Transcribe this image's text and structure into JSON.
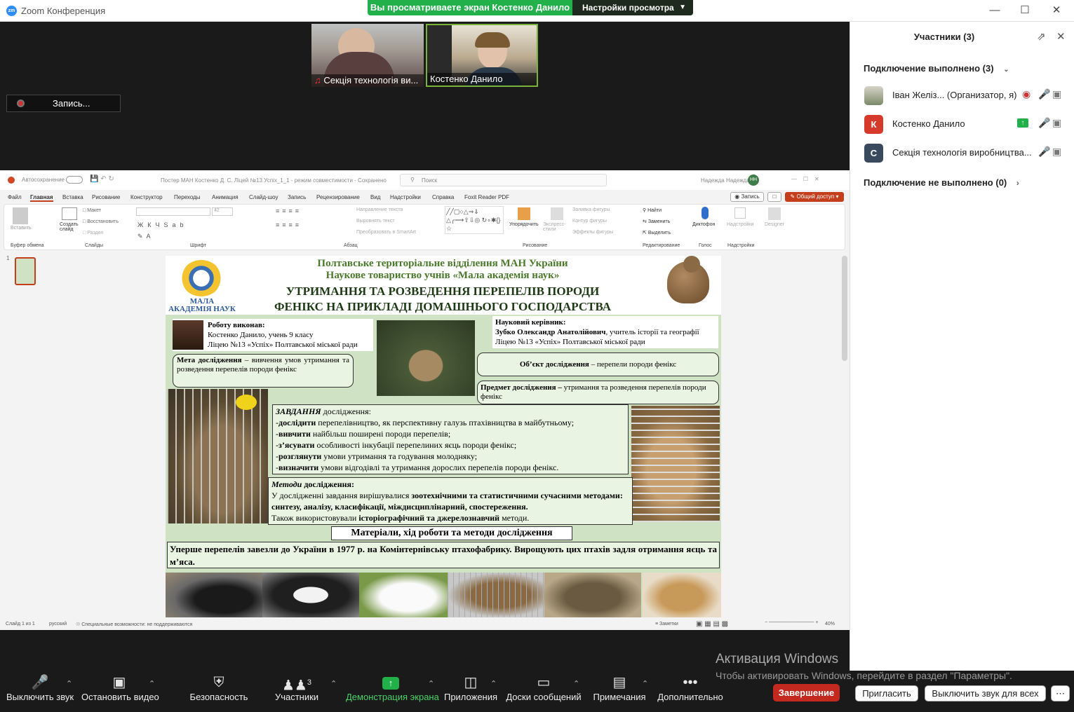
{
  "window": {
    "title": "Zoom Конференция",
    "banner": "Вы просматриваете экран Костенко Данило",
    "view_settings": "Настройки просмотра"
  },
  "videos": [
    {
      "name": "Секція технологія ви..."
    },
    {
      "name": "Костенко Данило"
    }
  ],
  "recording": {
    "label": "Запись..."
  },
  "ppt": {
    "titlebar": {
      "autosave": "Автосохранение",
      "doc": "Постер МАН Костенко Д. С. Лiцей №13 Успіх_1_1  -  режим совместимости  -  Сохранено",
      "search": "Поиск",
      "user": "Надежда Надежда",
      "initials": "НН"
    },
    "tabs": [
      "Файл",
      "Главная",
      "Вставка",
      "Рисование",
      "Конструктор",
      "Переходы",
      "Анимация",
      "Слайд-шоу",
      "Запись",
      "Рецензирование",
      "Вид",
      "Надстройки",
      "Справка",
      "Foxit Reader PDF"
    ],
    "record_btn": "Запись",
    "share_btn": "Общий доступ",
    "groups": [
      "Буфер обмена",
      "Слайды",
      "Шрифт",
      "Абзац",
      "Рисование",
      "Редактирование",
      "Голос",
      "Надстройки"
    ],
    "ribbon_items": {
      "paste": "Вставить",
      "create": "Создать слайд",
      "layout": "Макет",
      "restore": "Восстановить",
      "section": "Раздел",
      "dir": "Направление текста",
      "align": "Выровнять текст",
      "smartart": "Преобразовать в SmartArt",
      "arrange": "Упорядочить",
      "quick": "Экспресс-стили",
      "fill": "Заливка фигуры",
      "outline": "Контур фигуры",
      "effects": "Эффекты фигуры",
      "find": "Найти",
      "replace": "Заменить",
      "select": "Выделить",
      "dictate": "Диктофон",
      "addins": "Надстройки",
      "designer": "Designer",
      "font_size": "42"
    },
    "status": {
      "slide": "Слайд 1 из 1",
      "lang": "русский",
      "access": "Специальные возможности: не поддерживаются",
      "notes": "Заметки",
      "zoom": "40%"
    },
    "slide_num": "1"
  },
  "slide": {
    "org1": "Полтавське територіальне відділення МАН України",
    "org2": "Наукове товариство учнів «Мала академія наук»",
    "title1": "УТРИМАННЯ ТА РОЗВЕДЕННЯ ПЕРЕПЕЛІВ ПОРОДИ",
    "title2": "ФЕНІКС НА ПРИКЛАДІ ДОМАШНЬОГО ГОСПОДАРСТВА",
    "logo1": "МАЛА",
    "logo2": "АКАДЕМІЯ НАУК",
    "author_head": "Роботу виконав:",
    "author1": "Костенко Данило, учень 9 класу",
    "author2": "Ліцею №13 «Успіх» Полтавської міської ради",
    "sup_head": "Науковий керівник:",
    "sup_name": "Зубко Олександр Анатолійович",
    "sup_rest": ", учитель історії та географії",
    "sup2": "Ліцею №13 «Успіх» Полтавської міської ради",
    "goal_b": "Мета дослідження",
    "goal": " – вивчення умов утримання та розведення перепелів породи фенікс",
    "object_b": "Об’єкт дослідження",
    "object": " – перепели породи фенікс",
    "subject_b": "Предмет дослідження –",
    "subject": " утримання та розведення перепелів породи фенікс",
    "tasks_b": "ЗАВДАННЯ",
    "tasks_h": " дослідження:",
    "tasks": [
      {
        "b": "дослідити",
        "t": " перепелівництво, як перспективну галузь птахівництва в майбутньому;"
      },
      {
        "b": "вивчити",
        "t": " найбільш поширені породи перепелів;"
      },
      {
        "b": "з’ясувати",
        "t": " особливості інкубації перепелиних яєць породи фенікс;"
      },
      {
        "b": "розглянути",
        "t": " умови утримання та годування молодняку;"
      },
      {
        "b": "визначити",
        "t": " умови відгодівлі та утримання дорослих перепелів породи фенікс."
      }
    ],
    "methods_b": "Методи",
    "methods_h": " дослідження:",
    "methods1": "У дослідженні завдання вирішувалися ",
    "methods1b": "зоотехнічними та статистичними сучасними методами: синтезу, аналізу, класифікації, міждисциплінарний, спостереження.",
    "methods2": "Також використовували ",
    "methods2b": "історіографічний та джерелознавчий",
    "methods2e": " методи.",
    "materials": "Матеріали, хід роботи та методи дослідження",
    "intro": "Уперше перепелів завезли до України в 1977 р. на Комінтернівську птахофабрику. Вирощують цих птахів задля отримання яєць та м’яса."
  },
  "panel": {
    "title": "Участники (3)",
    "connected": "Подключение выполнено (3)",
    "not_connected": "Подключение не выполнено (0)",
    "participants": [
      {
        "name": "Іван Желіз... (Организатор, я)",
        "initial": ""
      },
      {
        "name": "Костенко Данило",
        "initial": "К"
      },
      {
        "name": "Секція технологія виробництва...",
        "initial": "С"
      }
    ],
    "invite": "Пригласить",
    "mute_all": "Выключить звук для всех"
  },
  "toolbar": {
    "mute": "Выключить звук",
    "video": "Остановить видео",
    "security": "Безопасность",
    "participants": "Участники",
    "participants_count": "3",
    "share": "Демонстрация экрана",
    "apps": "Приложения",
    "whiteboards": "Доски сообщений",
    "notes": "Примечания",
    "more": "Дополнительно",
    "end": "Завершение"
  },
  "windows": {
    "activate": "Активация Windows",
    "hint": "Чтобы активировать Windows, перейдите в раздел \"Параметры\"."
  },
  "colors": {
    "accent_green": "#22b04b",
    "end_red": "#c4291f",
    "slide_green": "#cfe3c4",
    "title_green": "#4a7a2a",
    "title_dark": "#1d3a14"
  }
}
